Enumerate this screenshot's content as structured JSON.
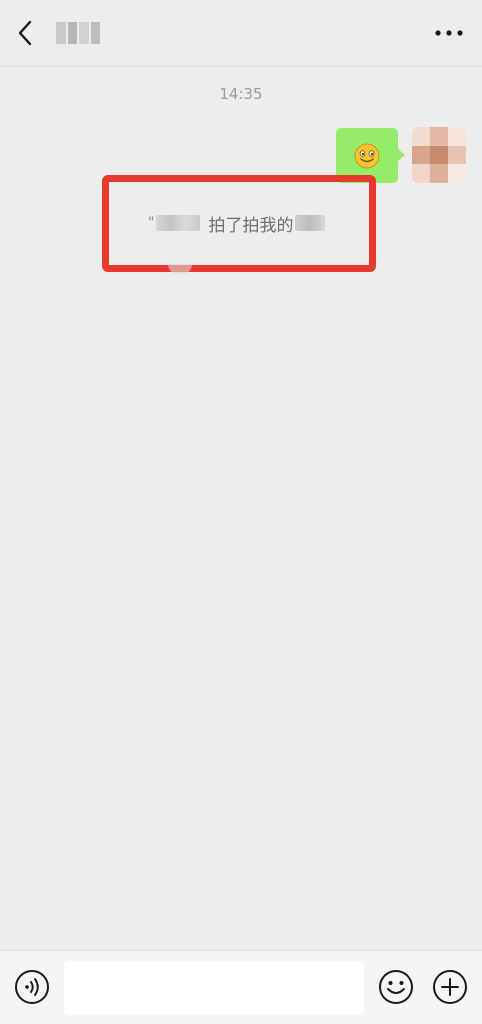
{
  "header": {
    "back_icon": "chevron-left-icon",
    "more_icon": "more-dots-icon"
  },
  "chat": {
    "timestamp": "14:35",
    "sent_message": {
      "emoji_icon": "smiley-emoji-icon"
    },
    "pat_notice": {
      "quote": "\"",
      "action_text": "拍了拍我的"
    }
  },
  "input_bar": {
    "voice_icon": "voice-icon",
    "input_placeholder": "",
    "emoji_icon": "emoji-icon",
    "plus_icon": "plus-circle-icon"
  },
  "colors": {
    "background": "#ededed",
    "bubble_green": "#95ec69",
    "highlight_red": "#e8392f",
    "timestamp_gray": "#9b9b9b"
  }
}
